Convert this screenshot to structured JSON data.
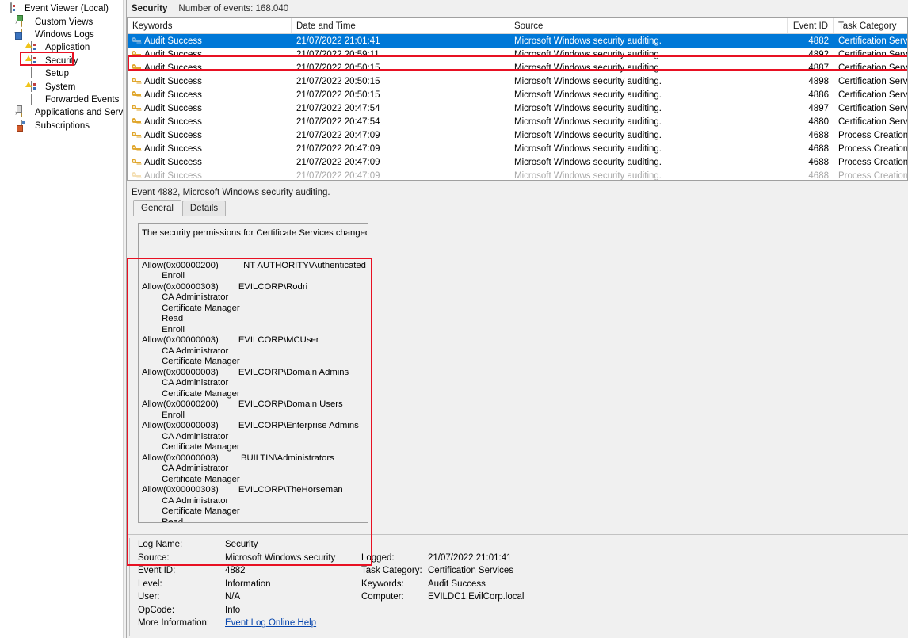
{
  "window": {
    "app_title": "Event Viewer (Local)"
  },
  "sidebar": {
    "items": [
      {
        "label": "Event Viewer (Local)",
        "icon": "console-icon",
        "indent": 0,
        "expander": "",
        "icon_kind": "console"
      },
      {
        "label": "Custom Views",
        "icon": "folder-green-icon",
        "indent": 1,
        "expander": "›",
        "icon_kind": "folder-green"
      },
      {
        "label": "Windows Logs",
        "icon": "folder-blue-icon",
        "indent": 1,
        "expander": "∨",
        "icon_kind": "folder-blue"
      },
      {
        "label": "Application",
        "icon": "log-icon",
        "indent": 2,
        "expander": "",
        "icon_kind": "log-dots"
      },
      {
        "label": "Security",
        "icon": "log-icon",
        "indent": 2,
        "expander": "",
        "icon_kind": "log-dots"
      },
      {
        "label": "Setup",
        "icon": "log-icon",
        "indent": 2,
        "expander": "",
        "icon_kind": "log-lines"
      },
      {
        "label": "System",
        "icon": "log-icon",
        "indent": 2,
        "expander": "",
        "icon_kind": "log-dots"
      },
      {
        "label": "Forwarded Events",
        "icon": "log-icon",
        "indent": 2,
        "expander": "",
        "icon_kind": "log-lines"
      },
      {
        "label": "Applications and Services Lo",
        "icon": "folder-lock-icon",
        "indent": 1,
        "expander": "›",
        "icon_kind": "folder-lock"
      },
      {
        "label": "Subscriptions",
        "icon": "subscriptions-icon",
        "indent": 1,
        "expander": "",
        "icon_kind": "subs"
      }
    ],
    "selected_label": "Security"
  },
  "list_caption": {
    "title": "Security",
    "count_text": "Number of events: 168.040"
  },
  "events_table": {
    "columns": [
      {
        "key": "keywords",
        "label": "Keywords",
        "align": "left"
      },
      {
        "key": "datetime",
        "label": "Date and Time",
        "align": "left"
      },
      {
        "key": "source",
        "label": "Source",
        "align": "left"
      },
      {
        "key": "event_id",
        "label": "Event ID",
        "align": "right"
      },
      {
        "key": "task",
        "label": "Task Category",
        "align": "left"
      }
    ],
    "rows": [
      {
        "keywords": "Audit Success",
        "datetime": "21/07/2022 21:01:41",
        "source": "Microsoft Windows security auditing.",
        "event_id": "4882",
        "task": "Certification Services",
        "selected": true
      },
      {
        "keywords": "Audit Success",
        "datetime": "21/07/2022 20:59:11",
        "source": "Microsoft Windows security auditing.",
        "event_id": "4892",
        "task": "Certification Services",
        "selected": false
      },
      {
        "keywords": "Audit Success",
        "datetime": "21/07/2022 20:50:15",
        "source": "Microsoft Windows security auditing.",
        "event_id": "4887",
        "task": "Certification Services",
        "selected": false
      },
      {
        "keywords": "Audit Success",
        "datetime": "21/07/2022 20:50:15",
        "source": "Microsoft Windows security auditing.",
        "event_id": "4898",
        "task": "Certification Services",
        "selected": false
      },
      {
        "keywords": "Audit Success",
        "datetime": "21/07/2022 20:50:15",
        "source": "Microsoft Windows security auditing.",
        "event_id": "4886",
        "task": "Certification Services",
        "selected": false
      },
      {
        "keywords": "Audit Success",
        "datetime": "21/07/2022 20:47:54",
        "source": "Microsoft Windows security auditing.",
        "event_id": "4897",
        "task": "Certification Services",
        "selected": false
      },
      {
        "keywords": "Audit Success",
        "datetime": "21/07/2022 20:47:54",
        "source": "Microsoft Windows security auditing.",
        "event_id": "4880",
        "task": "Certification Services",
        "selected": false
      },
      {
        "keywords": "Audit Success",
        "datetime": "21/07/2022 20:47:09",
        "source": "Microsoft Windows security auditing.",
        "event_id": "4688",
        "task": "Process Creation",
        "selected": false
      },
      {
        "keywords": "Audit Success",
        "datetime": "21/07/2022 20:47:09",
        "source": "Microsoft Windows security auditing.",
        "event_id": "4688",
        "task": "Process Creation",
        "selected": false
      },
      {
        "keywords": "Audit Success",
        "datetime": "21/07/2022 20:47:09",
        "source": "Microsoft Windows security auditing.",
        "event_id": "4688",
        "task": "Process Creation",
        "selected": false
      },
      {
        "keywords": "Audit Success",
        "datetime": "21/07/2022 20:47:09",
        "source": "Microsoft Windows security auditing.",
        "event_id": "4688",
        "task": "Process Creation",
        "selected": false
      }
    ]
  },
  "detail": {
    "title": "Event 4882, Microsoft Windows security auditing.",
    "tabs": [
      {
        "label": "General",
        "active": true
      },
      {
        "label": "Details",
        "active": false
      }
    ],
    "general_text": "The security permissions for Certificate Services changed.\n\n\nAllow(0x00000200)          NT AUTHORITY\\Authenticated Users\n        Enroll\nAllow(0x00000303)        EVILCORP\\Rodri\n        CA Administrator\n        Certificate Manager\n        Read\n        Enroll\nAllow(0x00000003)        EVILCORP\\MCUser\n        CA Administrator\n        Certificate Manager\nAllow(0x00000003)        EVILCORP\\Domain Admins\n        CA Administrator\n        Certificate Manager\nAllow(0x00000200)        EVILCORP\\Domain Users\n        Enroll\nAllow(0x00000003)        EVILCORP\\Enterprise Admins\n        CA Administrator\n        Certificate Manager\nAllow(0x00000003)         BUILTIN\\Administrators\n        CA Administrator\n        Certificate Manager\nAllow(0x00000303)        EVILCORP\\TheHorseman\n        CA Administrator\n        Certificate Manager\n        Read"
  },
  "meta": {
    "rows": [
      {
        "label": "Log Name:",
        "value": "Security",
        "label2": "",
        "value2": ""
      },
      {
        "label": "Source:",
        "value": "Microsoft Windows security",
        "label2": "Logged:",
        "value2": "21/07/2022 21:01:41"
      },
      {
        "label": "Event ID:",
        "value": "4882",
        "label2": "Task Category:",
        "value2": "Certification Services"
      },
      {
        "label": "Level:",
        "value": "Information",
        "label2": "Keywords:",
        "value2": "Audit Success"
      },
      {
        "label": "User:",
        "value": "N/A",
        "label2": "Computer:",
        "value2": "EVILDC1.EvilCorp.local"
      },
      {
        "label": "OpCode:",
        "value": "Info",
        "label2": "",
        "value2": ""
      }
    ],
    "more_info_label": "More Information:",
    "more_info_link": "Event Log Online Help"
  },
  "colors": {
    "selection_blue": "#0078d7",
    "annotation_red": "#e81123",
    "link_blue": "#0645ad",
    "chrome_gray": "#f0f0f0"
  }
}
